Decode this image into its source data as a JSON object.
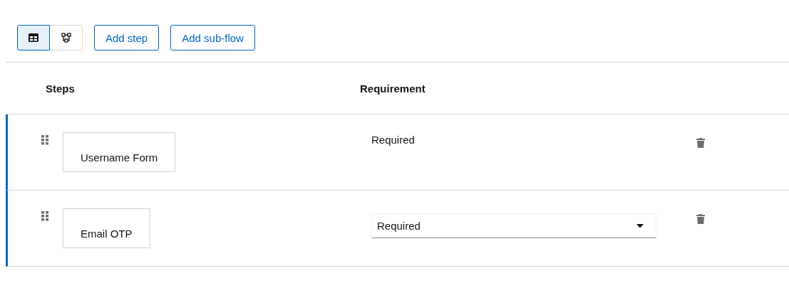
{
  "view_toggle": [
    {
      "kind": "table",
      "selected": true
    },
    {
      "kind": "diagram",
      "selected": false
    }
  ],
  "buttons": [
    "Add step",
    "Add sub-flow"
  ],
  "table": {
    "columns": [
      "Steps",
      "Requirement"
    ],
    "rows": [
      {
        "step": "Username Form",
        "requirement": {
          "kind": "text",
          "value": "Required"
        }
      },
      {
        "step": "Email OTP",
        "requirement": {
          "kind": "select",
          "value": "Required"
        }
      }
    ]
  }
}
